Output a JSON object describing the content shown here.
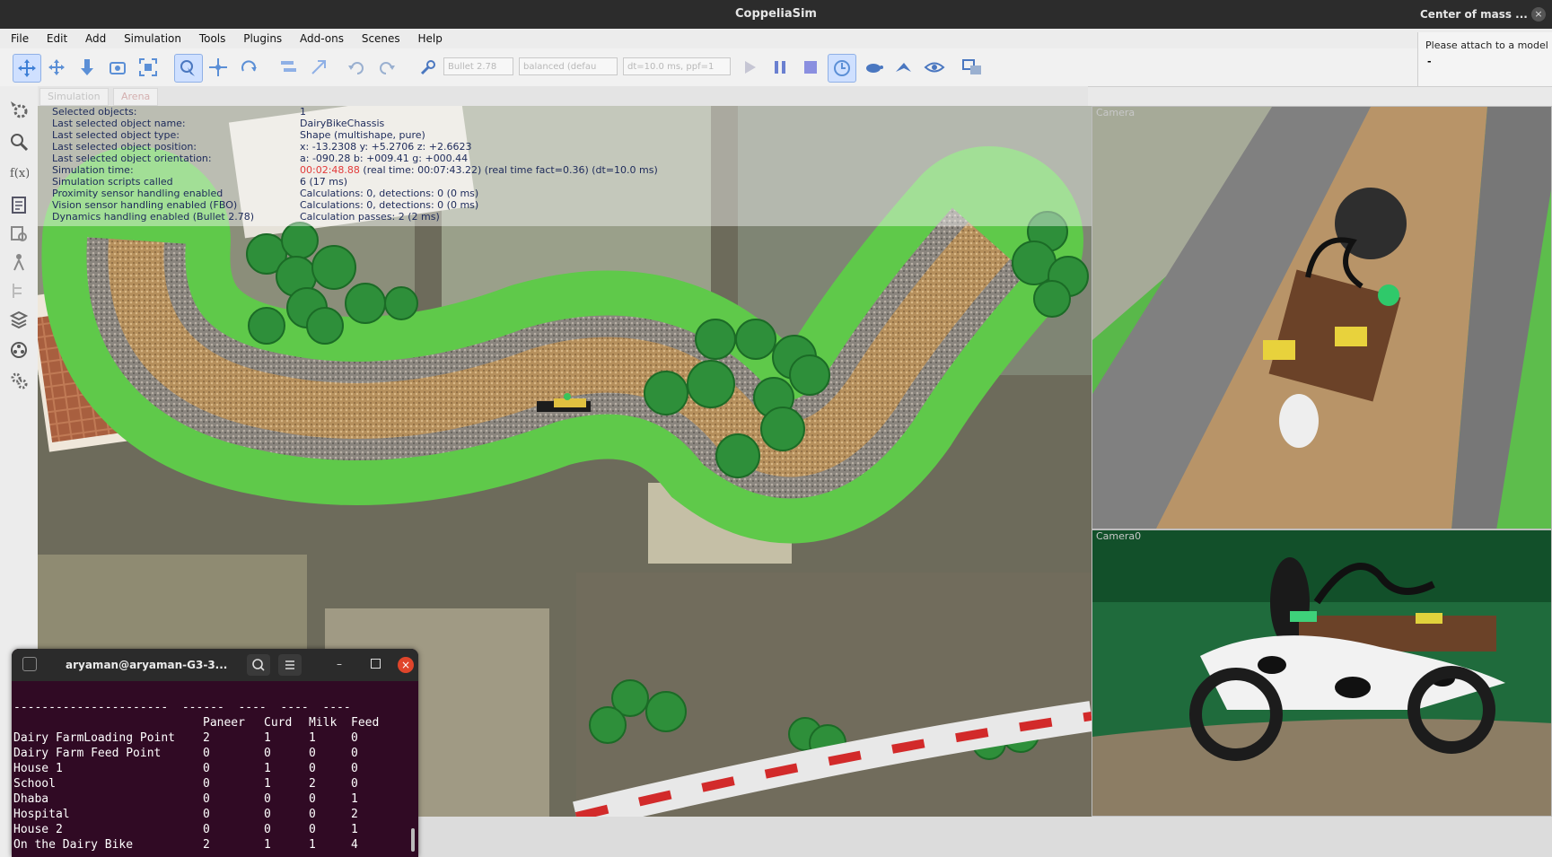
{
  "window": {
    "title": "CoppeliaSim",
    "popup_title": "Center of mass ...",
    "popup_text": "Please attach to a model",
    "popup_value": "-"
  },
  "menu": [
    "File",
    "Edit",
    "Add",
    "Simulation",
    "Tools",
    "Plugins",
    "Add-ons",
    "Scenes",
    "Help"
  ],
  "toolbar": {
    "engine": "Bullet 2.78",
    "mode": "balanced (defau",
    "dt": "dt=10.0 ms, ppf=1"
  },
  "tabs": [
    "Simulation",
    "Arena"
  ],
  "info": {
    "labels": [
      "Selected objects:",
      "Last selected object name:",
      "Last selected object type:",
      "Last selected object position:",
      "Last selected object orientation:",
      "Simulation time:",
      "Simulation scripts called",
      "Proximity sensor handling enabled",
      "Vision sensor handling enabled (FBO)",
      "Dynamics handling enabled (Bullet 2.78)"
    ],
    "values": [
      "1",
      "DairyBikeChassis",
      "Shape (multishape, pure)",
      "x: -13.2308   y: +5.2706   z: +2.6623",
      "a: -090.28   b: +009.41   g: +000.44",
      "",
      "6 (17 ms)",
      "Calculations: 0, detections: 0 (0 ms)",
      "Calculations: 0, detections: 0 (0 ms)",
      "Calculation passes: 2 (2 ms)"
    ],
    "sim_time_highlight": "00:02:48.88",
    "sim_time_rest": "(real time: 00:07:43.22) (real time fact=0.36) (dt=10.0 ms)"
  },
  "cameras": {
    "top": "Camera",
    "bottom": "Camera0"
  },
  "terminal": {
    "title": "aryaman@aryaman-G3-3...",
    "header_cols": [
      "Paneer",
      "Curd",
      "Milk",
      "Feed"
    ],
    "rows": [
      {
        "name": "Dairy FarmLoading Point",
        "paneer": "2",
        "curd": "1",
        "milk": "1",
        "feed": "0"
      },
      {
        "name": "Dairy Farm Feed Point",
        "paneer": "0",
        "curd": "0",
        "milk": "0",
        "feed": "0"
      },
      {
        "name": "House 1",
        "paneer": "0",
        "curd": "1",
        "milk": "0",
        "feed": "0"
      },
      {
        "name": "School",
        "paneer": "0",
        "curd": "1",
        "milk": "2",
        "feed": "0"
      },
      {
        "name": "Dhaba",
        "paneer": "0",
        "curd": "0",
        "milk": "0",
        "feed": "1"
      },
      {
        "name": "Hospital",
        "paneer": "0",
        "curd": "0",
        "milk": "0",
        "feed": "2"
      },
      {
        "name": "House 2",
        "paneer": "0",
        "curd": "0",
        "milk": "0",
        "feed": "1"
      },
      {
        "name": "On the Dairy Bike",
        "paneer": "2",
        "curd": "1",
        "milk": "1",
        "feed": "4"
      }
    ]
  },
  "colors": {
    "accent": "#cfe0ff",
    "grass": "#59c44a",
    "track": "#b99a6a",
    "terminal_bg": "#300a24",
    "close_button": "#e0452b"
  }
}
